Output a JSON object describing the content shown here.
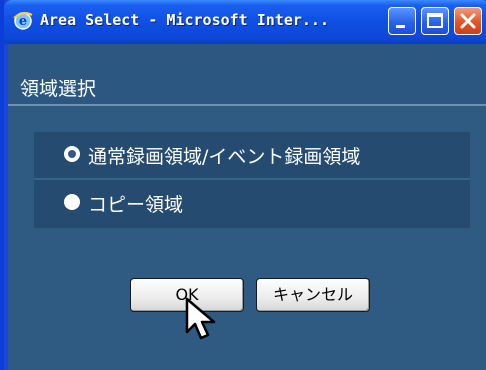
{
  "window": {
    "title": "Area Select - Microsoft Inter...",
    "buttons": [
      "minimize",
      "maximize",
      "close"
    ]
  },
  "header": {
    "title": "領域選択"
  },
  "options": [
    {
      "label": "通常録画領域/イベント録画領域",
      "checked": true
    },
    {
      "label": "コピー領域",
      "checked": false
    }
  ],
  "buttons": {
    "ok_label": "OK",
    "cancel_label": "キャンセル"
  },
  "icons": {
    "app": "ie-icon",
    "cursor": "mouse-pointer-icon"
  },
  "colors": {
    "titlebar": "#0d48d8",
    "content_bg": "#2f5b82",
    "close_button": "#e0562a"
  }
}
